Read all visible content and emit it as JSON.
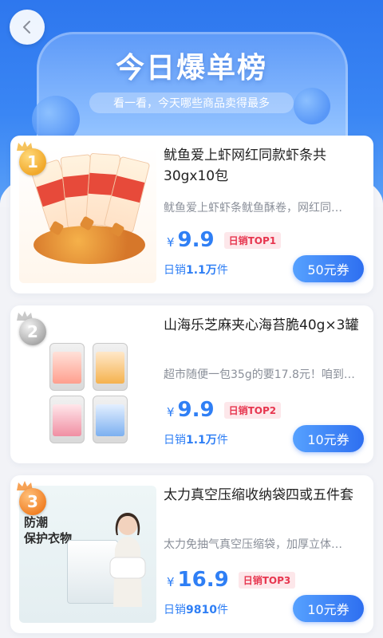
{
  "header": {
    "back_label": "<",
    "title": "今日爆单榜",
    "subtitle": "看一看，今天哪些商品卖得最多"
  },
  "products": [
    {
      "rank": "1",
      "title": "鱿鱼爱上虾网红同款虾条共30gx10包",
      "desc": "鱿鱼爱上虾虾条鱿鱼酥卷，网红同…",
      "currency": "¥",
      "price": "9.9",
      "top_tag": "日销TOP1",
      "sales_prefix": "日销",
      "sales_value": "1.1万",
      "sales_suffix": "件",
      "coupon": "50元券"
    },
    {
      "rank": "2",
      "title": "山海乐芝麻夹心海苔脆40g×3罐",
      "desc": "超市随便一包35g的要17.8元！咱到…",
      "currency": "¥",
      "price": "9.9",
      "top_tag": "日销TOP2",
      "sales_prefix": "日销",
      "sales_value": "1.1万",
      "sales_suffix": "件",
      "coupon": "10元券"
    },
    {
      "rank": "3",
      "title": "太力真空压缩收纳袋四或五件套",
      "desc": "太力免抽气真空压缩袋，加厚立体…",
      "currency": "¥",
      "price": "16.9",
      "top_tag": "日销TOP3",
      "sales_prefix": "日销",
      "sales_value": "9810",
      "sales_suffix": "件",
      "coupon": "10元券",
      "image_text": "防潮\n保护衣物"
    }
  ],
  "colors": {
    "accent": "#2f7ff5",
    "tag_text": "#e7364f",
    "tag_bg": "#fde7ea"
  }
}
